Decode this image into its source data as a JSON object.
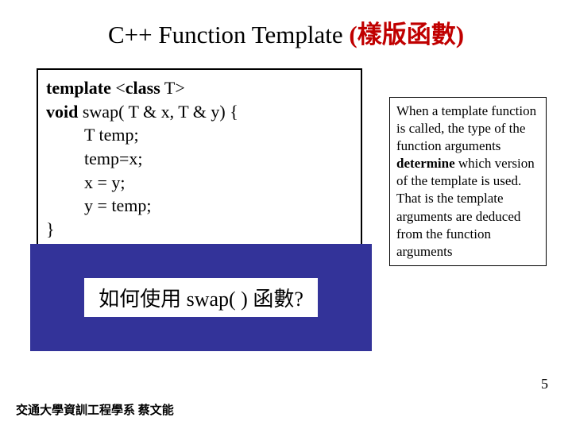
{
  "title": {
    "en": "C++ Function Template ",
    "cn": "(樣版函數)"
  },
  "code": {
    "l1a": "template",
    "l1b": " <",
    "l1c": "class",
    "l1d": " T>",
    "l2a": "void",
    "l2b": " swap( T & x, T & y) {",
    "l3": "T  temp;",
    "l4": "temp=x;",
    "l5": "x = y;",
    "l6": "y = temp;",
    "l7": "}"
  },
  "question": "如何使用 swap( ) 函數?",
  "note": {
    "p1": "When a template function is called, the type of the function arguments ",
    "p2": "determine",
    "p3": " which version of the template is used. That is the template arguments are deduced from the function arguments"
  },
  "footer": "交通大學資訓工程學系 蔡文能",
  "page": "5"
}
